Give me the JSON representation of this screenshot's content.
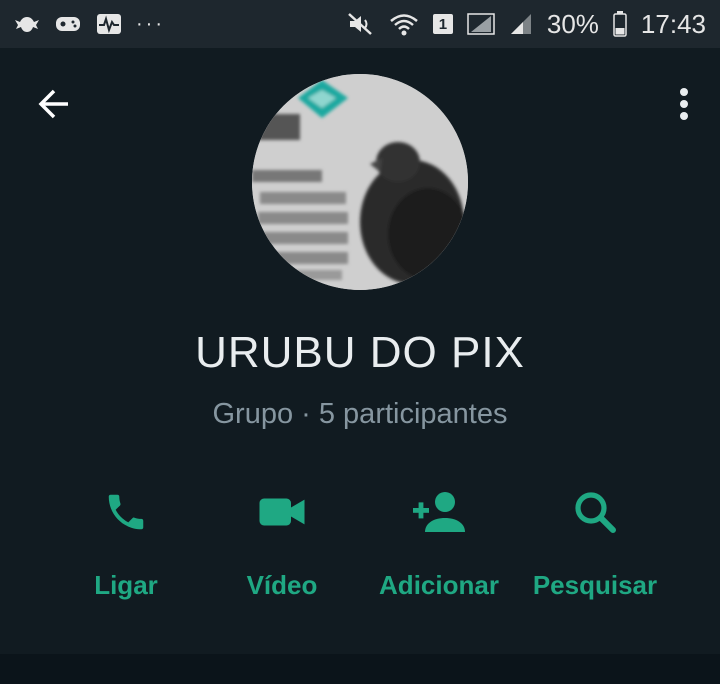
{
  "status_bar": {
    "left_icons": [
      "bat-icon",
      "game-controller-icon",
      "activity-icon",
      "more-dots-icon"
    ],
    "more_dots": "···",
    "sim_badge": "1",
    "battery_percent": "30%",
    "time": "17:43"
  },
  "header": {
    "back_icon": "arrow-back-icon",
    "menu_icon": "more-vert-icon"
  },
  "group": {
    "name": "URUBU DO PIX",
    "subtitle": "Grupo · 5 participantes"
  },
  "actions": [
    {
      "label": "Ligar",
      "icon": "phone-icon"
    },
    {
      "label": "Vídeo",
      "icon": "video-icon"
    },
    {
      "label": "Adicionar",
      "icon": "add-person-icon"
    },
    {
      "label": "Pesquisar",
      "icon": "search-icon"
    }
  ],
  "colors": {
    "accent": "#1fa883",
    "background": "#111b21",
    "status_bar": "#1e272e",
    "subtitle": "#8696a0"
  }
}
